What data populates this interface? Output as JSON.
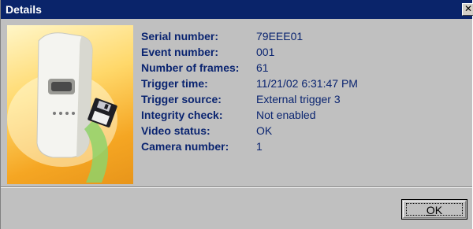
{
  "window": {
    "title": "Details",
    "close_glyph": "✕"
  },
  "image": {
    "icon_name": "motion-detector-camera-with-floppy-disk"
  },
  "details": [
    {
      "label": "Serial number:",
      "value": "79EEE01"
    },
    {
      "label": "Event number:",
      "value": "001"
    },
    {
      "label": "Number of frames:",
      "value": "61"
    },
    {
      "label": "Trigger time:",
      "value": "11/21/02 6:31:47 PM"
    },
    {
      "label": "Trigger source:",
      "value": "External trigger 3"
    },
    {
      "label": "Integrity check:",
      "value": "Not enabled"
    },
    {
      "label": "Video status:",
      "value": "OK"
    },
    {
      "label": "Camera number:",
      "value": "1"
    }
  ],
  "footer": {
    "ok_label_mnemonic": "O",
    "ok_label_rest": "K"
  },
  "colors": {
    "titlebar": "#0a246a",
    "label_text": "#0a2470",
    "dialog_bg": "#c0c0c0"
  }
}
